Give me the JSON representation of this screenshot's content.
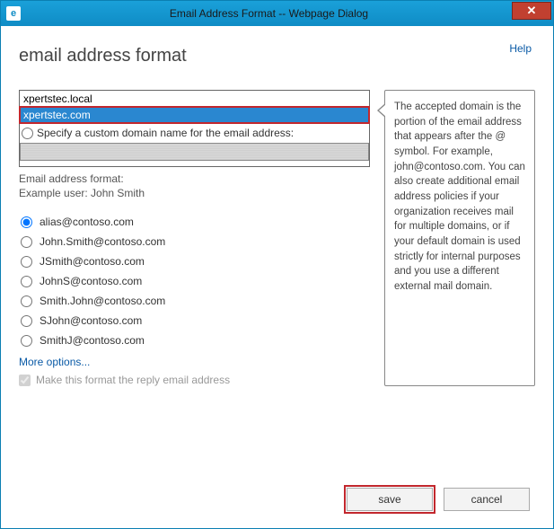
{
  "window": {
    "title": "Email Address Format -- Webpage Dialog"
  },
  "help_label": "Help",
  "page_title": "email address format",
  "domains": {
    "items": [
      {
        "label": "xpertstec.local",
        "selected": false
      },
      {
        "label": "xpertstec.com",
        "selected": true
      }
    ]
  },
  "custom_domain": {
    "radio_label": "Specify a custom domain name for the email address:",
    "value": ""
  },
  "format_label_1": "Email address format:",
  "format_label_2": "Example user: John Smith",
  "formats": [
    {
      "label": "alias@contoso.com",
      "checked": true
    },
    {
      "label": "John.Smith@contoso.com",
      "checked": false
    },
    {
      "label": "JSmith@contoso.com",
      "checked": false
    },
    {
      "label": "JohnS@contoso.com",
      "checked": false
    },
    {
      "label": "Smith.John@contoso.com",
      "checked": false
    },
    {
      "label": "SJohn@contoso.com",
      "checked": false
    },
    {
      "label": "SmithJ@contoso.com",
      "checked": false
    }
  ],
  "more_options_label": "More options...",
  "reply_checkbox": {
    "label": "Make this format the reply email address",
    "checked": true,
    "disabled": true
  },
  "tooltip_text": "The accepted domain is the portion of the email address that appears after the @ symbol. For example, john@contoso.com. You can also create additional email address policies if your organization receives mail for multiple domains, or if your default domain is used strictly for internal purposes and you use a different external mail domain.",
  "buttons": {
    "save": "save",
    "cancel": "cancel"
  }
}
